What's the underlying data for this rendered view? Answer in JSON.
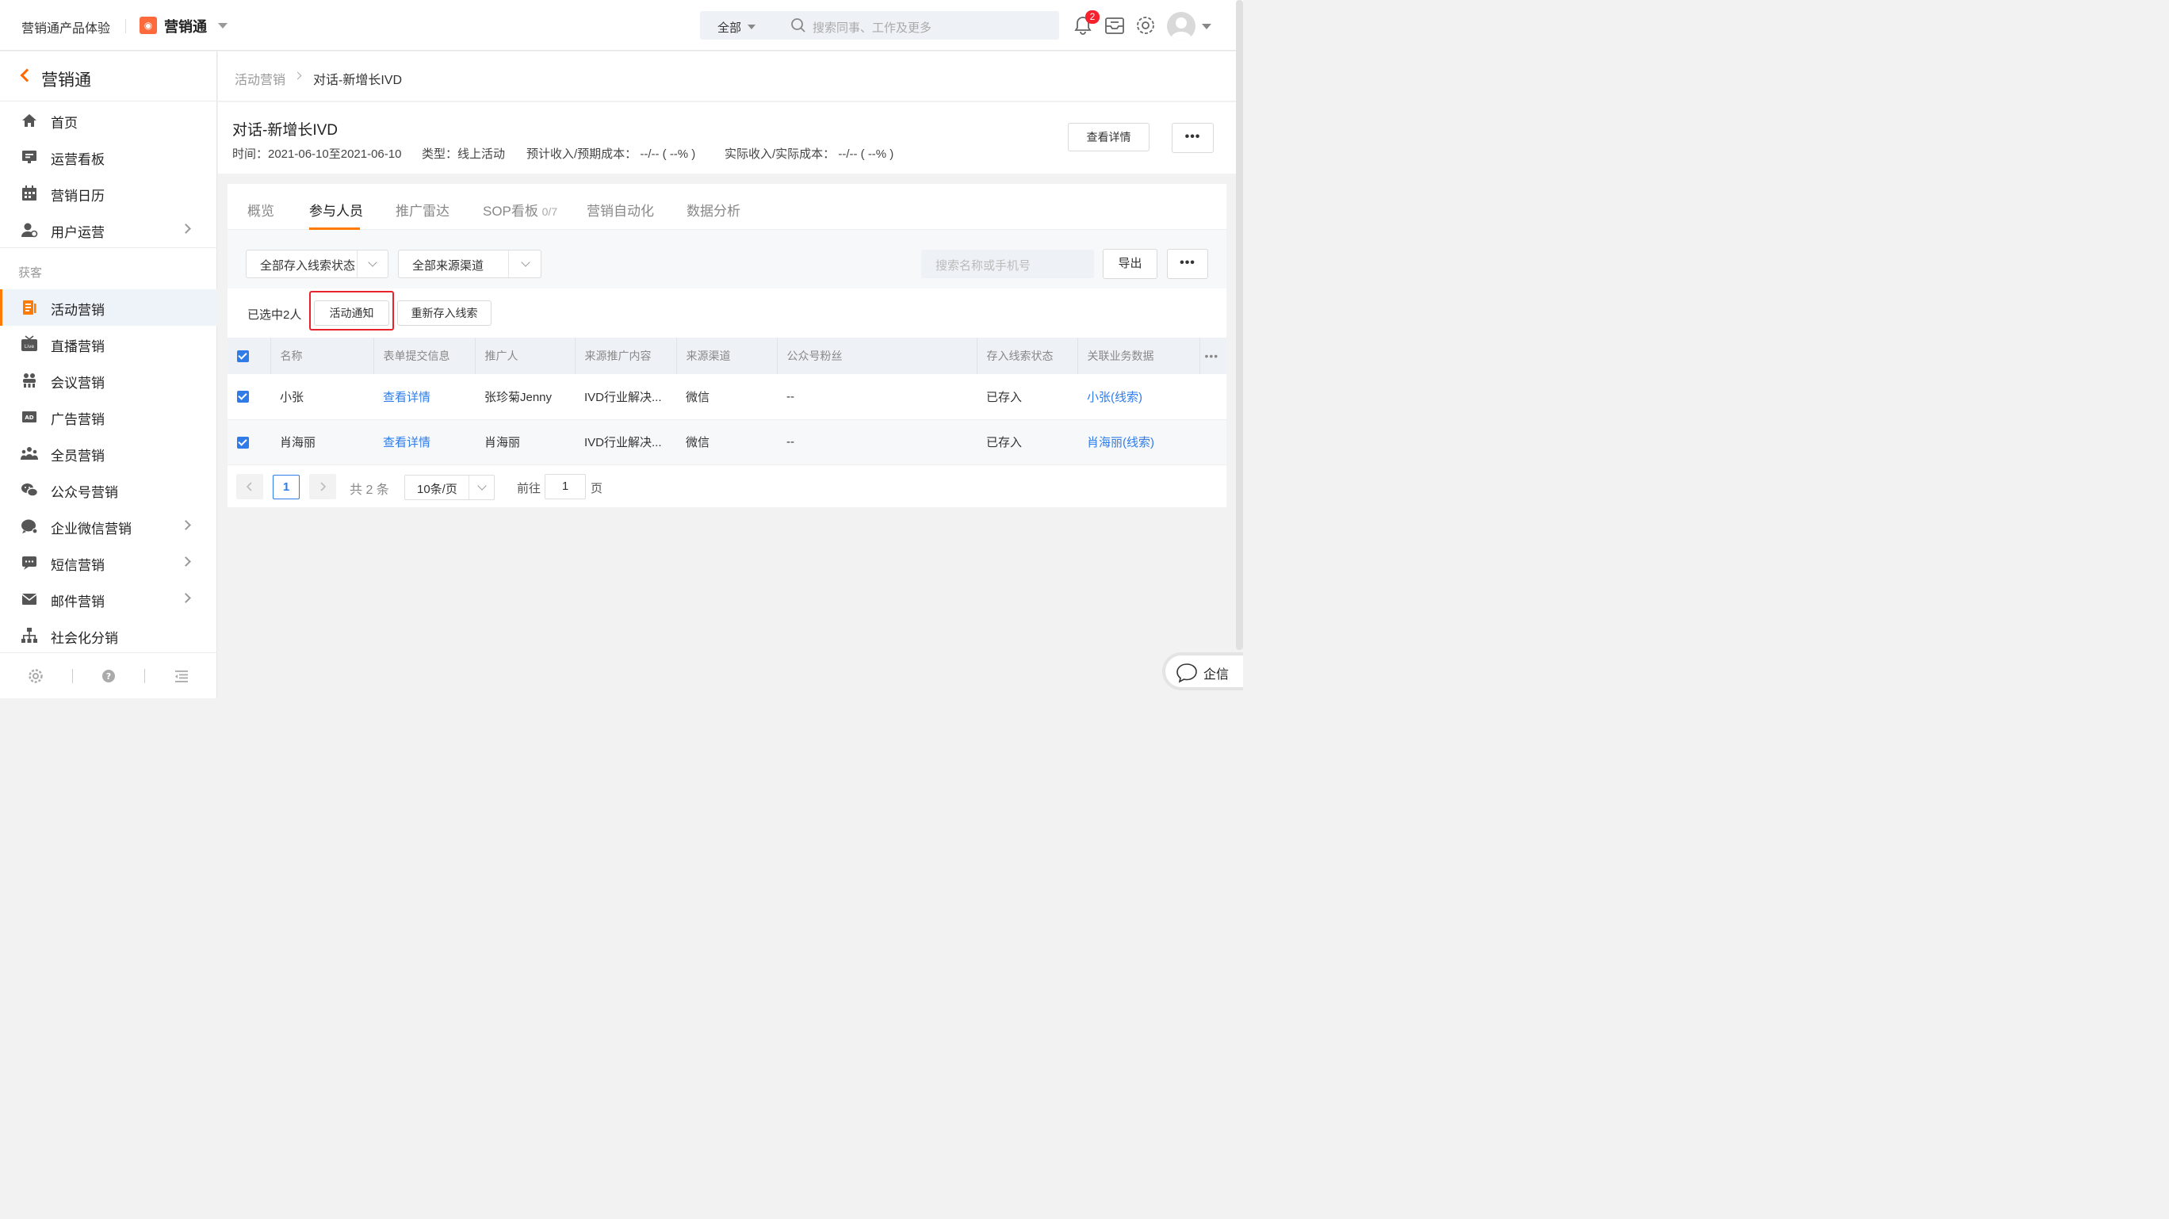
{
  "topbar": {
    "product": "营销通产品体验",
    "app_name": "营销通",
    "search_scope": "全部",
    "search_placeholder": "搜索同事、工作及更多",
    "notification_count": "2",
    "icons": [
      "bell-icon",
      "inbox-icon",
      "gear-icon",
      "avatar"
    ]
  },
  "sidebar": {
    "back_title": "营销通",
    "items_top": [
      {
        "label": "首页",
        "icon": "home-icon"
      },
      {
        "label": "运营看板",
        "icon": "dashboard-icon"
      },
      {
        "label": "营销日历",
        "icon": "calendar-icon"
      },
      {
        "label": "用户运营",
        "icon": "user-ops-icon",
        "has_children": true
      }
    ],
    "group_label": "获客",
    "items_group": [
      {
        "label": "活动营销",
        "icon": "activity-icon",
        "active": true
      },
      {
        "label": "直播营销",
        "icon": "live-icon"
      },
      {
        "label": "会议营销",
        "icon": "meeting-icon"
      },
      {
        "label": "广告营销",
        "icon": "ad-icon"
      },
      {
        "label": "全员营销",
        "icon": "team-icon"
      },
      {
        "label": "公众号营销",
        "icon": "wechat-icon"
      },
      {
        "label": "企业微信营销",
        "icon": "wecom-icon",
        "has_children": true
      },
      {
        "label": "短信营销",
        "icon": "sms-icon",
        "has_children": true
      },
      {
        "label": "邮件营销",
        "icon": "mail-icon",
        "has_children": true
      },
      {
        "label": "社会化分销",
        "icon": "distribution-icon"
      }
    ],
    "footer_icons": [
      "settings-icon",
      "help-icon",
      "collapse-menu-icon"
    ]
  },
  "breadcrumb": {
    "parent": "活动营销",
    "current": "对话-新增长IVD"
  },
  "header": {
    "title": "对话-新增长IVD",
    "time": "时间：2021-06-10至2021-06-10",
    "type": "类型：线上活动",
    "expected": "预计收入/预期成本：  --/-- ( --% )",
    "actual": "实际收入/实际成本：  --/-- ( --% )",
    "detail_button": "查看详情",
    "more_button": "•••"
  },
  "tabs": [
    {
      "label": "概览"
    },
    {
      "label": "参与人员",
      "active": true
    },
    {
      "label": "推广雷达"
    },
    {
      "label": "SOP看板",
      "count": "0/7"
    },
    {
      "label": "营销自动化"
    },
    {
      "label": "数据分析"
    }
  ],
  "filters": {
    "lead_status": "全部存入线索状态",
    "source_channel": "全部来源渠道",
    "search_placeholder": "搜索名称或手机号",
    "export_button": "导出",
    "more_button": "•••"
  },
  "selection": {
    "text": "已选中2人",
    "notify_button": "活动通知",
    "restore_button": "重新存入线索"
  },
  "table": {
    "columns": [
      "名称",
      "表单提交信息",
      "推广人",
      "来源推广内容",
      "来源渠道",
      "公众号粉丝",
      "存入线索状态",
      "关联业务数据"
    ],
    "more": "•••",
    "rows": [
      {
        "name": "小张",
        "form": "查看详情",
        "promoter": "张珍菊Jenny",
        "content": "IVD行业解决...",
        "channel": "微信",
        "fans": "--",
        "status": "已存入",
        "related": "小张(线索)"
      },
      {
        "name": "肖海丽",
        "form": "查看详情",
        "promoter": "肖海丽",
        "content": "IVD行业解决...",
        "channel": "微信",
        "fans": "--",
        "status": "已存入",
        "related": "肖海丽(线索)"
      }
    ]
  },
  "pager": {
    "current": "1",
    "total": "共 2 条",
    "page_size": "10条/页",
    "goto_label": "前往",
    "goto_value": "1",
    "page_label": "页"
  },
  "float_button": {
    "label": "企信"
  },
  "colors": {
    "accent": "#ff7a00",
    "primary": "#2f7ce8",
    "highlight": "#e8232c"
  }
}
